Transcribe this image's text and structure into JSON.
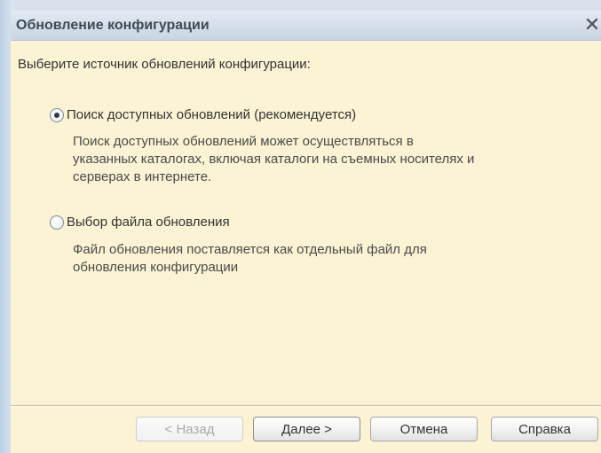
{
  "dialog": {
    "title": "Обновление конфигурации",
    "close_symbol": "✕"
  },
  "prompt": "Выберите источник обновлений конфигурации:",
  "options": [
    {
      "label": "Поиск доступных обновлений (рекомендуется)",
      "selected": true,
      "description_lines": [
        "Поиск доступных обновлений может осуществляться в",
        "указанных каталогах, включая каталоги на съемных носителях и",
        "серверах в интернете."
      ]
    },
    {
      "label": "Выбор файла обновления",
      "selected": false,
      "description_lines": [
        "Файл обновления поставляется как отдельный файл для",
        "обновления конфигурации"
      ]
    }
  ],
  "buttons": {
    "back": "< Назад",
    "next": "Далее >",
    "cancel": "Отмена",
    "help": "Справка"
  },
  "colors": {
    "dialog_background": "#fbf3d4",
    "title_text": "#3c4a5a",
    "disabled_text": "#a9a9a9"
  }
}
